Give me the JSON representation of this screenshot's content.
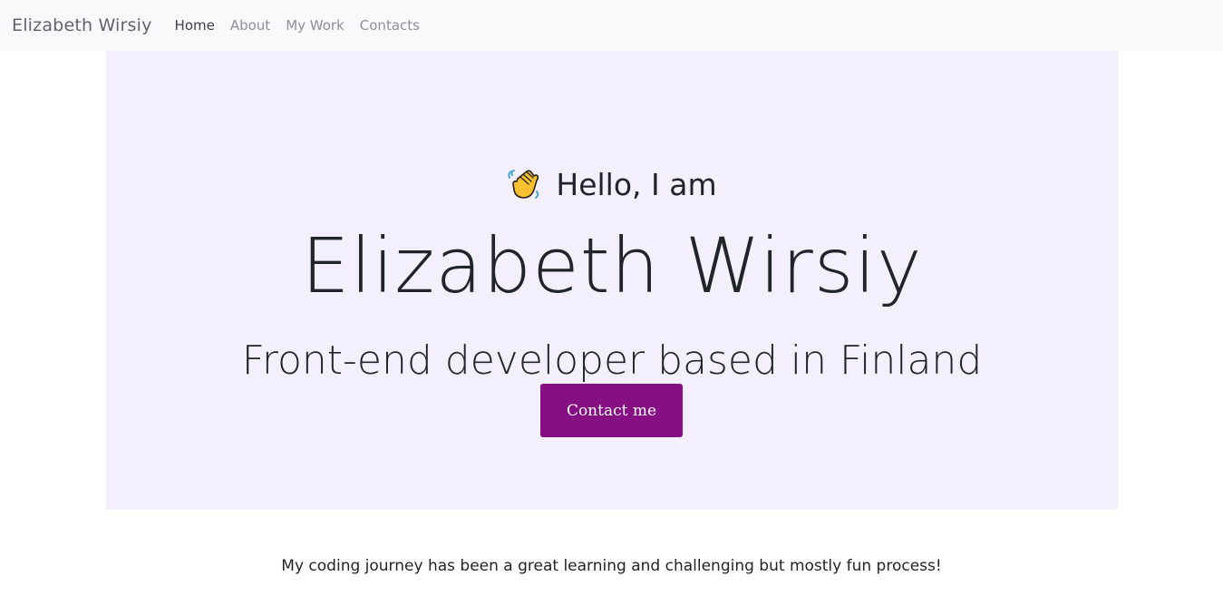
{
  "navbar": {
    "brand": "Elizabeth Wirsiy",
    "links": [
      {
        "label": "Home",
        "active": true
      },
      {
        "label": "About",
        "active": false
      },
      {
        "label": "My Work",
        "active": false
      },
      {
        "label": "Contacts",
        "active": false
      }
    ]
  },
  "hero": {
    "greeting": "Hello, I am",
    "greeting_icon": "waving-hand-icon",
    "name": "Elizabeth Wirsiy",
    "subtitle": "Front-end developer based in Finland",
    "cta_label": "Contact me",
    "background_color": "#f3effd",
    "cta_color": "#870f84"
  },
  "intro": {
    "text": "My coding journey has been a great learning and challenging but mostly fun process!"
  }
}
